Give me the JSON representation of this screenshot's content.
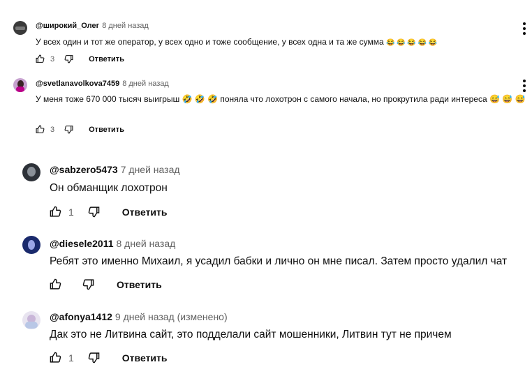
{
  "comments": [
    {
      "author": "@широкий_Олег",
      "time": "8 дней назад",
      "text": "У всех один и тот же оператор, у всех одно и тоже сообщение, у всех одна и та же сумма",
      "emojis": "😂 😂 😂 😂 😂",
      "likes": "3",
      "reply": "Ответить"
    },
    {
      "author": "@svetlanavolkova7459",
      "time": "8 дней назад",
      "text": "У меня тоже 670 000 тысяч выигрыш 🤣 🤣 🤣 поняла что лохотрон с самого начала, но прокрутила ради интереса 😅 😅 😅",
      "likes": "3",
      "reply": "Ответить"
    },
    {
      "author": "@sabzero5473",
      "time": "7 дней назад",
      "text": "Он обманщик лохотрон",
      "likes": "1",
      "reply": "Ответить"
    },
    {
      "author": "@diesele2011",
      "time": "8 дней назад",
      "text": "Ребят это именно Михаил, я усадил бабки и лично он мне писал. Затем просто удалил чат",
      "likes": "",
      "reply": "Ответить"
    },
    {
      "author": "@afonya1412",
      "time": "9 дней назад (изменено)",
      "text": "Дак это не Литвина сайт, это подделали сайт мошенники, Литвин тут не причем",
      "likes": "1",
      "reply": "Ответить"
    }
  ],
  "colors": {
    "text": "#0f0f0f",
    "muted": "#606060"
  },
  "icons": [
    "more-vert-icon",
    "like-icon",
    "dislike-icon"
  ]
}
